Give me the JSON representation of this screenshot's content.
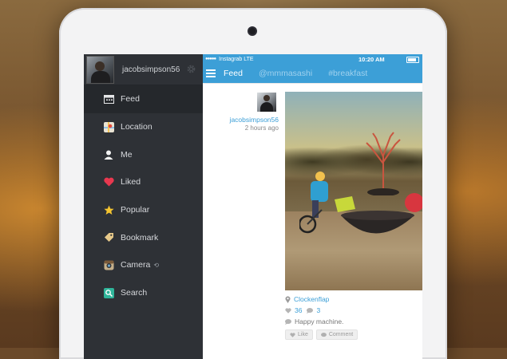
{
  "statusbar": {
    "carrier": "Instagrab LTE",
    "time": "10:20 AM"
  },
  "sidebar": {
    "username": "jacobsimpson56",
    "items": [
      {
        "label": "Feed",
        "icon": "calendar-icon",
        "active": true
      },
      {
        "label": "Location",
        "icon": "map-icon",
        "active": false
      },
      {
        "label": "Me",
        "icon": "person-icon",
        "active": false
      },
      {
        "label": "Liked",
        "icon": "heart-icon",
        "active": false
      },
      {
        "label": "Popular",
        "icon": "star-icon",
        "active": false
      },
      {
        "label": "Bookmark",
        "icon": "tag-icon",
        "active": false
      },
      {
        "label": "Camera",
        "icon": "camera-icon",
        "active": false,
        "badge": "⟲"
      },
      {
        "label": "Search",
        "icon": "search-icon",
        "active": false
      }
    ]
  },
  "topbar": {
    "tabs": [
      {
        "label": "Feed",
        "active": true
      },
      {
        "label": "@mmmasashi",
        "active": false
      },
      {
        "label": "#breakfast",
        "active": false
      }
    ]
  },
  "post": {
    "username": "jacobsimpson56",
    "time": "2 hours ago",
    "location": "Clockenflap",
    "likes": "36",
    "comments": "3",
    "caption": "Happy machine.",
    "like_label": "Like",
    "comment_label": "Comment"
  },
  "colors": {
    "accent": "#3c9fd7",
    "sidebar": "#2e3136"
  }
}
